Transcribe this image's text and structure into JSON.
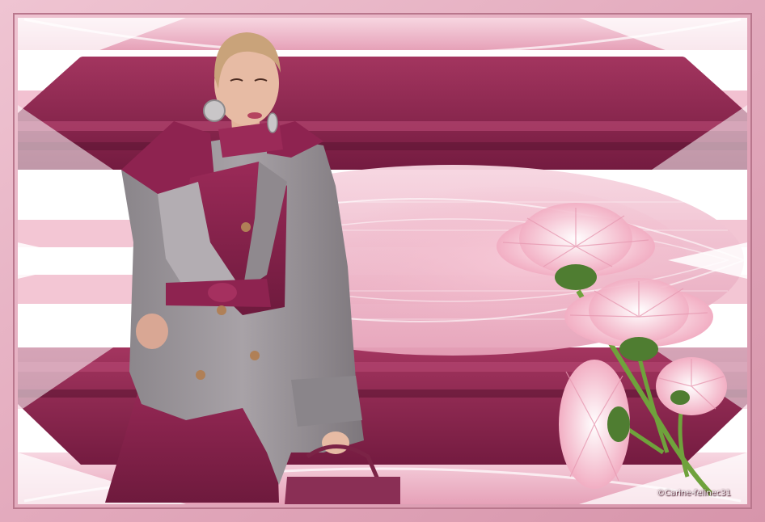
{
  "artwork": {
    "credit": "©Carine-felinec31",
    "colors": {
      "frame": "#e6b3c5",
      "frame_dark": "#c98ea3",
      "burgundy": "#8e2350",
      "burgundy_dark": "#6a1838",
      "pink_light": "#f4c8d6",
      "pink_mid": "#e9a3ba",
      "white": "#ffffff",
      "coat_grey": "#9a9499",
      "skin": "#e7bba4",
      "hair": "#c9a37a",
      "flower_pink": "#f6c9d6",
      "flower_center": "#4f7d31",
      "stem_green": "#6fa23c"
    }
  }
}
